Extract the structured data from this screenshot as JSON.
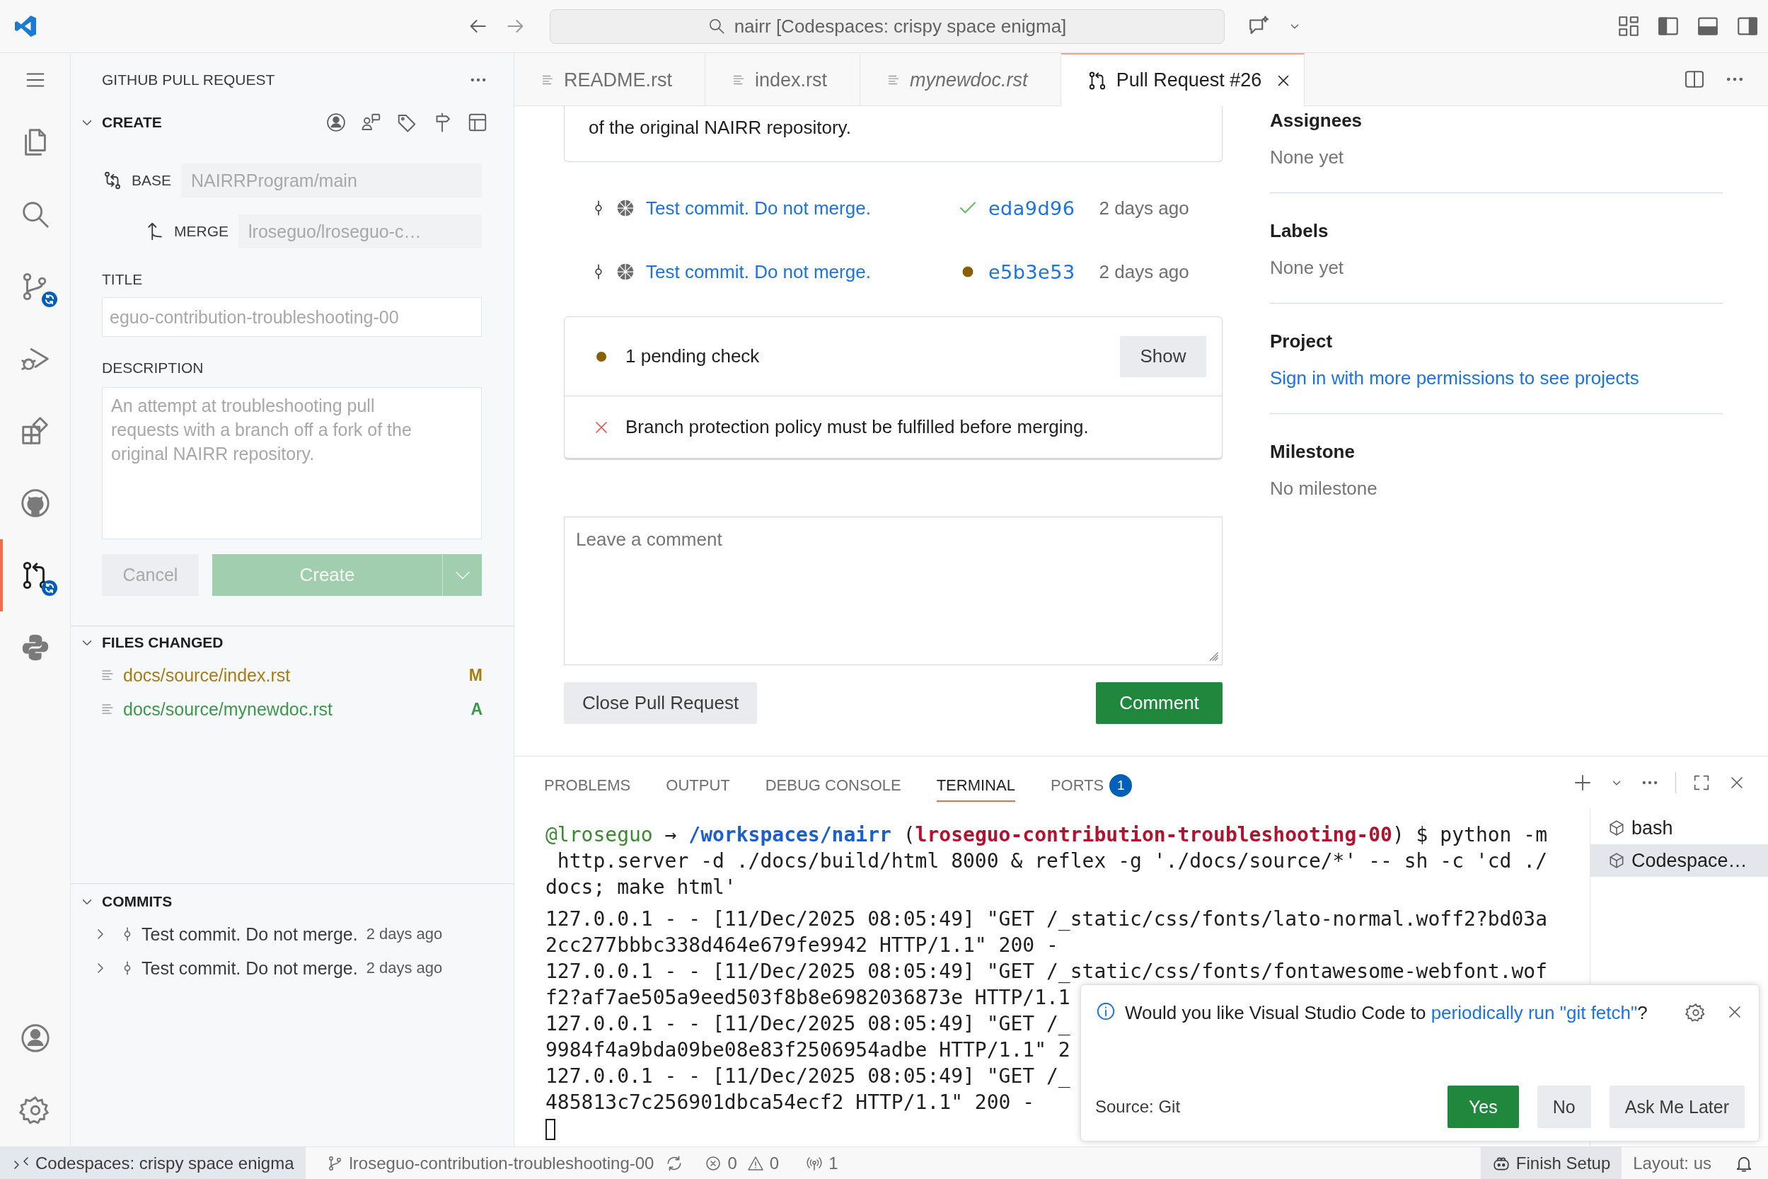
{
  "title_bar": {
    "search": "nairr [Codespaces: crispy space enigma]"
  },
  "activity_bar": {
    "items": [
      {
        "selected": false,
        "badge": false
      },
      {
        "selected": false,
        "badge": false
      },
      {
        "selected": false,
        "badge": true
      },
      {
        "selected": false,
        "badge": false
      },
      {
        "selected": false,
        "badge": false
      },
      {
        "selected": false,
        "badge": false
      },
      {
        "selected": true,
        "badge": true
      },
      {
        "selected": false,
        "badge": false
      }
    ]
  },
  "sidebar": {
    "title": "GITHUB PULL REQUEST",
    "create": {
      "header": "CREATE",
      "expanded": true,
      "base_label": "BASE",
      "base": "NAIRRProgram/main",
      "merge_label": "MERGE",
      "merge": "lroseguo/lroseguo-c…",
      "title_label": "TITLE",
      "title": "eguo-contribution-troubleshooting-00",
      "description_label": "DESCRIPTION",
      "description": "An attempt at troubleshooting pull requests with a branch off a fork of the original NAIRR repository.",
      "cancel_button": "Cancel",
      "create_button": "Create",
      "disabled": true
    },
    "files_changed": {
      "header": "FILES CHANGED",
      "expanded": true,
      "files": [
        {
          "path": "docs/source/index.rst",
          "status": "M",
          "color": "#a97c12"
        },
        {
          "path": "docs/source/mynewdoc.rst",
          "status": "A",
          "color": "#3a9a4a"
        }
      ]
    },
    "commits": {
      "header": "COMMITS",
      "expanded": true,
      "items": [
        {
          "message": "Test commit. Do not merge.",
          "time": "2 days ago",
          "expanded": false
        },
        {
          "message": "Test commit. Do not merge.",
          "time": "2 days ago",
          "expanded": false
        }
      ]
    }
  },
  "editor_tabs": [
    {
      "label": "README.rst",
      "kind": "file",
      "selected": false,
      "italic": false
    },
    {
      "label": "index.rst",
      "kind": "file",
      "selected": false,
      "italic": false
    },
    {
      "label": "mynewdoc.rst",
      "kind": "file",
      "selected": false,
      "italic": true
    },
    {
      "label": "Pull Request #26",
      "kind": "pull-request",
      "selected": true,
      "italic": false
    }
  ],
  "pull_request": {
    "description_tail": "of the original NAIRR repository.",
    "commits": [
      {
        "message": "Test commit. Do not merge.",
        "kind": "success",
        "hash": "eda9d96",
        "time": "2 days ago"
      },
      {
        "message": "Test commit. Do not merge.",
        "kind": "pending",
        "hash": "e5b3e53",
        "time": "2 days ago"
      }
    ],
    "checks": [
      {
        "kind": "pending",
        "text": "1 pending check",
        "button": "Show"
      },
      {
        "kind": "failure",
        "text": "Branch protection policy must be fulfilled before merging."
      }
    ],
    "comment": {
      "placeholder": "Leave a comment",
      "close_button": "Close Pull Request",
      "comment_button": "Comment"
    },
    "details": [
      {
        "heading": "Assignees",
        "value": "None yet",
        "kind": "text"
      },
      {
        "heading": "Labels",
        "value": "None yet",
        "kind": "text"
      },
      {
        "heading": "Project",
        "value": "Sign in with more permissions to see projects",
        "kind": "link"
      },
      {
        "heading": "Milestone",
        "value": "No milestone",
        "kind": "text"
      }
    ]
  },
  "panel": {
    "tabs": [
      {
        "label": "PROBLEMS",
        "selected": false
      },
      {
        "label": "OUTPUT",
        "selected": false
      },
      {
        "label": "DEBUG CONSOLE",
        "selected": false
      },
      {
        "label": "TERMINAL",
        "selected": true
      },
      {
        "label": "PORTS",
        "selected": false,
        "badge": "1"
      }
    ],
    "terminal": {
      "lines": [
        {
          "kind": "command",
          "segments": [
            {
              "kind": "user",
              "text": "@lroseguo"
            },
            {
              "kind": "plain",
              "text": " → "
            },
            {
              "kind": "path",
              "text": "/workspaces/nairr"
            },
            {
              "kind": "plain",
              "text": " ("
            },
            {
              "kind": "branch",
              "text": "lroseguo-contribution-troubleshooting-00"
            },
            {
              "kind": "plain",
              "text": ") $ python -m"
            }
          ]
        },
        {
          "kind": "command",
          "segments": [
            {
              "kind": "plain",
              "text": " http.server -d ./docs/build/html 8000 & reflex -g './docs/source/*' -- sh -c 'cd ./"
            }
          ]
        },
        {
          "kind": "command",
          "segments": [
            {
              "kind": "plain",
              "text": "docs; make html'"
            }
          ]
        },
        {
          "kind": "output",
          "segments": [
            {
              "kind": "plain",
              "text": "127.0.0.1 - - [11/Dec/2025 08:05:49] \"GET /_static/css/fonts/lato-normal.woff2?bd03a"
            }
          ]
        },
        {
          "kind": "output",
          "segments": [
            {
              "kind": "plain",
              "text": "2cc277bbbc338d464e679fe9942 HTTP/1.1\" 200 -"
            }
          ]
        },
        {
          "kind": "output",
          "segments": [
            {
              "kind": "plain",
              "text": "127.0.0.1 - - [11/Dec/2025 08:05:49] \"GET /_static/css/fonts/fontawesome-webfont.wof"
            }
          ]
        },
        {
          "kind": "output",
          "segments": [
            {
              "kind": "plain",
              "text": "f2?af7ae505a9eed503f8b8e6982036873e HTTP/1.1"
            }
          ]
        },
        {
          "kind": "output",
          "segments": [
            {
              "kind": "plain",
              "text": "127.0.0.1 - - [11/Dec/2025 08:05:49] \"GET /_"
            }
          ]
        },
        {
          "kind": "output",
          "segments": [
            {
              "kind": "plain",
              "text": "9984f4a9bda09be08e83f2506954adbe HTTP/1.1\" 2"
            }
          ]
        },
        {
          "kind": "output",
          "segments": [
            {
              "kind": "plain",
              "text": "127.0.0.1 - - [11/Dec/2025 08:05:49] \"GET /_"
            }
          ]
        },
        {
          "kind": "output",
          "segments": [
            {
              "kind": "plain",
              "text": "485813c7c256901dbca54ecf2 HTTP/1.1\" 200 -"
            }
          ]
        }
      ]
    },
    "terminals": [
      {
        "name": "bash",
        "selected": false
      },
      {
        "name": "Codespace…",
        "selected": true
      }
    ]
  },
  "notification": {
    "message": {
      "before": "Would you like Visual Studio Code to ",
      "link": "periodically run \"git fetch\"",
      "after": "?"
    },
    "source": "Source: Git",
    "buttons": [
      {
        "label": "Yes",
        "kind": "primary"
      },
      {
        "label": "No",
        "kind": "secondary"
      },
      {
        "label": "Ask Me Later",
        "kind": "secondary"
      }
    ]
  },
  "status_bar": {
    "remote": "Codespaces: crispy space enigma",
    "branch": "lroseguo-contribution-troubleshooting-00",
    "errors": "0",
    "warnings": "0",
    "ports": "1",
    "finish_setup": "Finish Setup",
    "layout": "Layout: us"
  }
}
